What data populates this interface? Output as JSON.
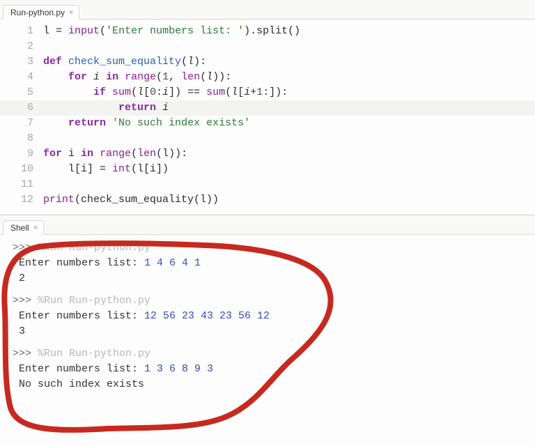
{
  "editor_tab": {
    "name": "Run-python.py"
  },
  "code_lines": [
    {
      "n": 1,
      "hl": false,
      "tokens": [
        [
          "plain",
          "l "
        ],
        [
          "plain",
          "= "
        ],
        [
          "builtin",
          "input"
        ],
        [
          "plain",
          "("
        ],
        [
          "str",
          "'Enter numbers list: '"
        ],
        [
          "plain",
          ")."
        ],
        [
          "plain",
          "split()"
        ]
      ]
    },
    {
      "n": 2,
      "hl": false,
      "tokens": []
    },
    {
      "n": 3,
      "hl": false,
      "tokens": [
        [
          "kw",
          "def"
        ],
        [
          "plain",
          " "
        ],
        [
          "def-name",
          "check_sum_equality"
        ],
        [
          "plain",
          "("
        ],
        [
          "param",
          "l"
        ],
        [
          "plain",
          "):"
        ]
      ]
    },
    {
      "n": 4,
      "hl": false,
      "tokens": [
        [
          "plain",
          "    "
        ],
        [
          "kw",
          "for"
        ],
        [
          "plain",
          " "
        ],
        [
          "param",
          "i"
        ],
        [
          "plain",
          " "
        ],
        [
          "kw",
          "in"
        ],
        [
          "plain",
          " "
        ],
        [
          "builtin",
          "range"
        ],
        [
          "plain",
          "("
        ],
        [
          "num",
          "1"
        ],
        [
          "plain",
          ", "
        ],
        [
          "builtin",
          "len"
        ],
        [
          "plain",
          "("
        ],
        [
          "param",
          "l"
        ],
        [
          "plain",
          ")):"
        ]
      ]
    },
    {
      "n": 5,
      "hl": false,
      "tokens": [
        [
          "plain",
          "        "
        ],
        [
          "kw",
          "if"
        ],
        [
          "plain",
          " "
        ],
        [
          "builtin",
          "sum"
        ],
        [
          "plain",
          "("
        ],
        [
          "param",
          "l"
        ],
        [
          "plain",
          "["
        ],
        [
          "num",
          "0"
        ],
        [
          "plain",
          ":"
        ],
        [
          "param",
          "i"
        ],
        [
          "plain",
          "]) == "
        ],
        [
          "builtin",
          "sum"
        ],
        [
          "plain",
          "("
        ],
        [
          "param",
          "l"
        ],
        [
          "plain",
          "["
        ],
        [
          "param",
          "i"
        ],
        [
          "plain",
          "+"
        ],
        [
          "num",
          "1"
        ],
        [
          "plain",
          ":]):"
        ]
      ]
    },
    {
      "n": 6,
      "hl": true,
      "tokens": [
        [
          "plain",
          "            "
        ],
        [
          "kw",
          "return"
        ],
        [
          "plain",
          " "
        ],
        [
          "param",
          "i"
        ]
      ]
    },
    {
      "n": 7,
      "hl": false,
      "tokens": [
        [
          "plain",
          "    "
        ],
        [
          "kw",
          "return"
        ],
        [
          "plain",
          " "
        ],
        [
          "str",
          "'No such index exists'"
        ]
      ]
    },
    {
      "n": 8,
      "hl": false,
      "tokens": []
    },
    {
      "n": 9,
      "hl": false,
      "tokens": [
        [
          "kw",
          "for"
        ],
        [
          "plain",
          " i "
        ],
        [
          "kw",
          "in"
        ],
        [
          "plain",
          " "
        ],
        [
          "builtin",
          "range"
        ],
        [
          "plain",
          "("
        ],
        [
          "builtin",
          "len"
        ],
        [
          "plain",
          "(l)):"
        ]
      ]
    },
    {
      "n": 10,
      "hl": false,
      "tokens": [
        [
          "plain",
          "    l[i] = "
        ],
        [
          "builtin",
          "int"
        ],
        [
          "plain",
          "(l[i])"
        ]
      ]
    },
    {
      "n": 11,
      "hl": false,
      "tokens": []
    },
    {
      "n": 12,
      "hl": false,
      "tokens": [
        [
          "builtin",
          "print"
        ],
        [
          "plain",
          "(check_sum_equality(l))"
        ]
      ]
    }
  ],
  "shell_tab": {
    "name": "Shell"
  },
  "shell": {
    "prompt": ">>>",
    "run_cmd": "%Run Run-python.py",
    "input_label": "Enter numbers list: ",
    "sessions": [
      {
        "input": "1 4 6 4 1",
        "output": "2"
      },
      {
        "input": "12 56 23 43 23 56 12",
        "output": "3"
      },
      {
        "input": "1 3 6 8 9 3",
        "output": "No such index exists"
      }
    ]
  }
}
